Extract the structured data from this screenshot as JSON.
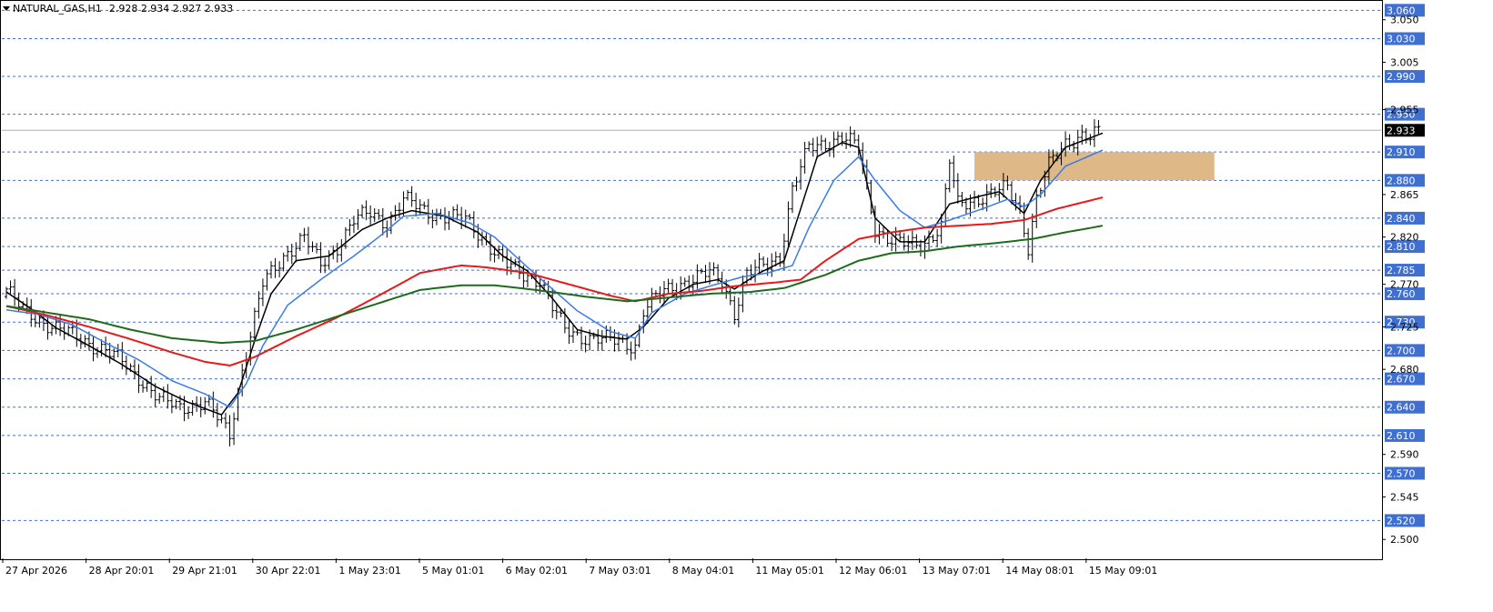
{
  "header": {
    "symbol_label": "NATURAL_GAS,H1",
    "ohlc": "2.928 2.934 2.927 2.933"
  },
  "colors": {
    "background": "#ffffff",
    "frame": "#000000",
    "level_line": "#4a6fc4",
    "level_label_bg": "#3f6fd0",
    "current_price_bg": "#000000",
    "current_price_line": "#b0b0b0",
    "zone": "#deb887",
    "price": "#000000",
    "ma_fast": "#000000",
    "ma_blue": "#3a7be8",
    "ma_red": "#e61a1a",
    "ma_green": "#1e6b1e"
  },
  "chart_data": {
    "type": "line",
    "title": "NATURAL_GAS,H1",
    "ylim": [
      2.48,
      3.068
    ],
    "y_ticks": [
      "3.050",
      "3.005",
      "2.955",
      "2.865",
      "2.820",
      "2.770",
      "2.725",
      "2.680",
      "2.590",
      "2.545",
      "2.500"
    ],
    "y_tick_values": [
      3.05,
      3.005,
      2.955,
      2.865,
      2.82,
      2.77,
      2.725,
      2.68,
      2.59,
      2.545,
      2.5
    ],
    "levels": [
      "3.060",
      "3.030",
      "2.990",
      "2.950",
      "2.910",
      "2.880",
      "2.840",
      "2.810",
      "2.785",
      "2.760",
      "2.730",
      "2.700",
      "2.670",
      "2.640",
      "2.610",
      "2.570",
      "2.520"
    ],
    "level_values": [
      3.06,
      3.03,
      2.99,
      2.95,
      2.91,
      2.88,
      2.84,
      2.81,
      2.785,
      2.76,
      2.73,
      2.7,
      2.67,
      2.64,
      2.61,
      2.57,
      2.52
    ],
    "current_price": "2.933",
    "current_price_value": 2.933,
    "x_labels": [
      "27 Apr 2026",
      "28 Apr 20:01",
      "29 Apr 21:01",
      "30 Apr 22:01",
      "1 May 23:01",
      "5 May 01:01",
      "6 May 02:01",
      "7 May 03:01",
      "8 May 04:01",
      "11 May 05:01",
      "12 May 06:01",
      "13 May 07:01",
      "14 May 08:01",
      "15 May 09:01"
    ],
    "zone": {
      "low": 2.88,
      "high": 2.91,
      "from_index": 234,
      "to_index": 292
    },
    "n_bars": 265,
    "price_anchors": [
      [
        0,
        2.765
      ],
      [
        4,
        2.742
      ],
      [
        10,
        2.728
      ],
      [
        18,
        2.712
      ],
      [
        24,
        2.7
      ],
      [
        28,
        2.688
      ],
      [
        32,
        2.672
      ],
      [
        37,
        2.648
      ],
      [
        42,
        2.64
      ],
      [
        48,
        2.645
      ],
      [
        54,
        2.612
      ],
      [
        57,
        2.68
      ],
      [
        62,
        2.77
      ],
      [
        68,
        2.805
      ],
      [
        72,
        2.82
      ],
      [
        76,
        2.79
      ],
      [
        80,
        2.81
      ],
      [
        84,
        2.838
      ],
      [
        88,
        2.845
      ],
      [
        92,
        2.835
      ],
      [
        96,
        2.86
      ],
      [
        101,
        2.848
      ],
      [
        106,
        2.842
      ],
      [
        111,
        2.838
      ],
      [
        115,
        2.82
      ],
      [
        118,
        2.805
      ],
      [
        121,
        2.79
      ],
      [
        125,
        2.78
      ],
      [
        129,
        2.775
      ],
      [
        132,
        2.745
      ],
      [
        135,
        2.722
      ],
      [
        139,
        2.715
      ],
      [
        143,
        2.712
      ],
      [
        148,
        2.71
      ],
      [
        152,
        2.705
      ],
      [
        154,
        2.742
      ],
      [
        158,
        2.76
      ],
      [
        162,
        2.77
      ],
      [
        166,
        2.775
      ],
      [
        170,
        2.782
      ],
      [
        173,
        2.775
      ],
      [
        176,
        2.74
      ],
      [
        179,
        2.78
      ],
      [
        183,
        2.79
      ],
      [
        187,
        2.8
      ],
      [
        190,
        2.87
      ],
      [
        194,
        2.915
      ],
      [
        198,
        2.92
      ],
      [
        202,
        2.925
      ],
      [
        206,
        2.915
      ],
      [
        210,
        2.83
      ],
      [
        214,
        2.815
      ],
      [
        218,
        2.812
      ],
      [
        222,
        2.815
      ],
      [
        226,
        2.83
      ],
      [
        228,
        2.9
      ],
      [
        230,
        2.855
      ],
      [
        234,
        2.86
      ],
      [
        238,
        2.865
      ],
      [
        242,
        2.872
      ],
      [
        245,
        2.85
      ],
      [
        247,
        2.81
      ],
      [
        249,
        2.86
      ],
      [
        252,
        2.895
      ],
      [
        256,
        2.92
      ],
      [
        260,
        2.928
      ],
      [
        262,
        2.925
      ],
      [
        265,
        2.933
      ]
    ],
    "series": [
      {
        "key": "ma_fast",
        "anchors": [
          [
            0,
            2.762
          ],
          [
            6,
            2.744
          ],
          [
            12,
            2.724
          ],
          [
            20,
            2.705
          ],
          [
            28,
            2.685
          ],
          [
            36,
            2.662
          ],
          [
            44,
            2.645
          ],
          [
            52,
            2.632
          ],
          [
            56,
            2.655
          ],
          [
            60,
            2.71
          ],
          [
            64,
            2.76
          ],
          [
            70,
            2.795
          ],
          [
            78,
            2.8
          ],
          [
            86,
            2.828
          ],
          [
            92,
            2.84
          ],
          [
            98,
            2.848
          ],
          [
            106,
            2.842
          ],
          [
            114,
            2.825
          ],
          [
            120,
            2.8
          ],
          [
            126,
            2.784
          ],
          [
            132,
            2.755
          ],
          [
            138,
            2.722
          ],
          [
            144,
            2.715
          ],
          [
            150,
            2.712
          ],
          [
            154,
            2.725
          ],
          [
            160,
            2.755
          ],
          [
            166,
            2.77
          ],
          [
            172,
            2.775
          ],
          [
            176,
            2.765
          ],
          [
            182,
            2.782
          ],
          [
            188,
            2.795
          ],
          [
            192,
            2.85
          ],
          [
            196,
            2.905
          ],
          [
            202,
            2.92
          ],
          [
            206,
            2.915
          ],
          [
            210,
            2.84
          ],
          [
            216,
            2.815
          ],
          [
            222,
            2.815
          ],
          [
            228,
            2.855
          ],
          [
            234,
            2.862
          ],
          [
            240,
            2.868
          ],
          [
            246,
            2.845
          ],
          [
            250,
            2.88
          ],
          [
            256,
            2.915
          ],
          [
            265,
            2.93
          ]
        ]
      },
      {
        "key": "ma_blue",
        "anchors": [
          [
            0,
            2.743
          ],
          [
            8,
            2.738
          ],
          [
            16,
            2.727
          ],
          [
            24,
            2.708
          ],
          [
            32,
            2.69
          ],
          [
            40,
            2.668
          ],
          [
            48,
            2.654
          ],
          [
            54,
            2.64
          ],
          [
            58,
            2.665
          ],
          [
            62,
            2.705
          ],
          [
            68,
            2.748
          ],
          [
            76,
            2.775
          ],
          [
            84,
            2.8
          ],
          [
            90,
            2.82
          ],
          [
            96,
            2.842
          ],
          [
            104,
            2.845
          ],
          [
            112,
            2.835
          ],
          [
            118,
            2.82
          ],
          [
            126,
            2.788
          ],
          [
            132,
            2.765
          ],
          [
            138,
            2.742
          ],
          [
            146,
            2.72
          ],
          [
            152,
            2.713
          ],
          [
            156,
            2.74
          ],
          [
            164,
            2.76
          ],
          [
            170,
            2.768
          ],
          [
            178,
            2.778
          ],
          [
            184,
            2.782
          ],
          [
            190,
            2.79
          ],
          [
            194,
            2.83
          ],
          [
            200,
            2.88
          ],
          [
            206,
            2.905
          ],
          [
            210,
            2.88
          ],
          [
            216,
            2.848
          ],
          [
            222,
            2.83
          ],
          [
            228,
            2.838
          ],
          [
            236,
            2.85
          ],
          [
            242,
            2.86
          ],
          [
            246,
            2.852
          ],
          [
            250,
            2.865
          ],
          [
            256,
            2.895
          ],
          [
            265,
            2.912
          ]
        ]
      },
      {
        "key": "ma_red",
        "anchors": [
          [
            0,
            2.747
          ],
          [
            10,
            2.737
          ],
          [
            20,
            2.725
          ],
          [
            30,
            2.712
          ],
          [
            40,
            2.698
          ],
          [
            48,
            2.688
          ],
          [
            54,
            2.684
          ],
          [
            60,
            2.693
          ],
          [
            70,
            2.715
          ],
          [
            80,
            2.735
          ],
          [
            90,
            2.758
          ],
          [
            100,
            2.782
          ],
          [
            110,
            2.79
          ],
          [
            116,
            2.788
          ],
          [
            126,
            2.782
          ],
          [
            136,
            2.77
          ],
          [
            146,
            2.758
          ],
          [
            152,
            2.752
          ],
          [
            160,
            2.76
          ],
          [
            168,
            2.763
          ],
          [
            176,
            2.768
          ],
          [
            186,
            2.772
          ],
          [
            192,
            2.775
          ],
          [
            198,
            2.795
          ],
          [
            206,
            2.818
          ],
          [
            214,
            2.825
          ],
          [
            222,
            2.83
          ],
          [
            230,
            2.832
          ],
          [
            238,
            2.834
          ],
          [
            246,
            2.838
          ],
          [
            254,
            2.85
          ],
          [
            265,
            2.862
          ]
        ]
      },
      {
        "key": "ma_green",
        "anchors": [
          [
            0,
            2.747
          ],
          [
            10,
            2.74
          ],
          [
            20,
            2.733
          ],
          [
            30,
            2.722
          ],
          [
            40,
            2.713
          ],
          [
            52,
            2.708
          ],
          [
            60,
            2.71
          ],
          [
            70,
            2.722
          ],
          [
            80,
            2.736
          ],
          [
            90,
            2.75
          ],
          [
            100,
            2.764
          ],
          [
            110,
            2.769
          ],
          [
            118,
            2.769
          ],
          [
            128,
            2.764
          ],
          [
            140,
            2.757
          ],
          [
            150,
            2.752
          ],
          [
            160,
            2.756
          ],
          [
            170,
            2.76
          ],
          [
            180,
            2.762
          ],
          [
            188,
            2.766
          ],
          [
            198,
            2.78
          ],
          [
            206,
            2.795
          ],
          [
            214,
            2.803
          ],
          [
            222,
            2.805
          ],
          [
            230,
            2.81
          ],
          [
            240,
            2.814
          ],
          [
            248,
            2.818
          ],
          [
            256,
            2.825
          ],
          [
            265,
            2.832
          ]
        ]
      }
    ]
  }
}
